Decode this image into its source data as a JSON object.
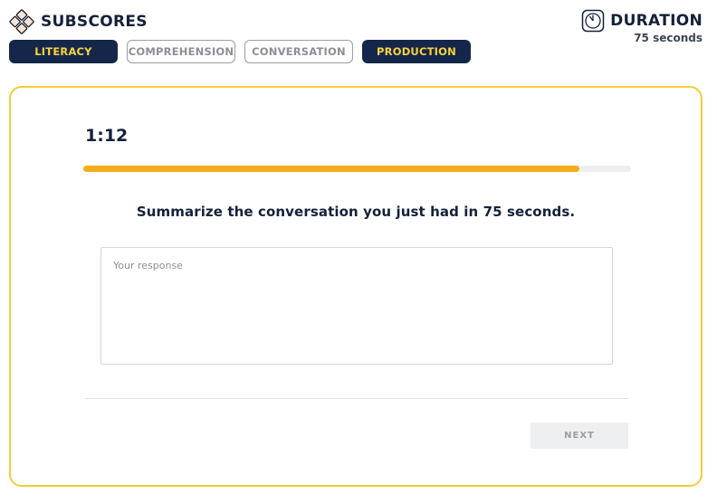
{
  "header": {
    "title": "SUBSCORES",
    "logo_icon": "diamond-grid-icon"
  },
  "duration": {
    "title": "DURATION",
    "value": "75 seconds",
    "icon": "clock-icon"
  },
  "tabs": [
    {
      "label": "LITERACY",
      "active": true
    },
    {
      "label": "COMPREHENSION",
      "active": false
    },
    {
      "label": "CONVERSATION",
      "active": false
    },
    {
      "label": "PRODUCTION",
      "active": true
    }
  ],
  "task": {
    "timer": "1:12",
    "progress_fraction": 0.905,
    "prompt": "Summarize the conversation you just had in 75 seconds.",
    "response_placeholder": "Your response",
    "response_value": "",
    "next_label": "NEXT"
  },
  "colors": {
    "accent_yellow": "#f3cd3a",
    "progress_orange": "#f2ad1b",
    "navy": "#14274a",
    "active_tab_text": "#f6d33c"
  }
}
